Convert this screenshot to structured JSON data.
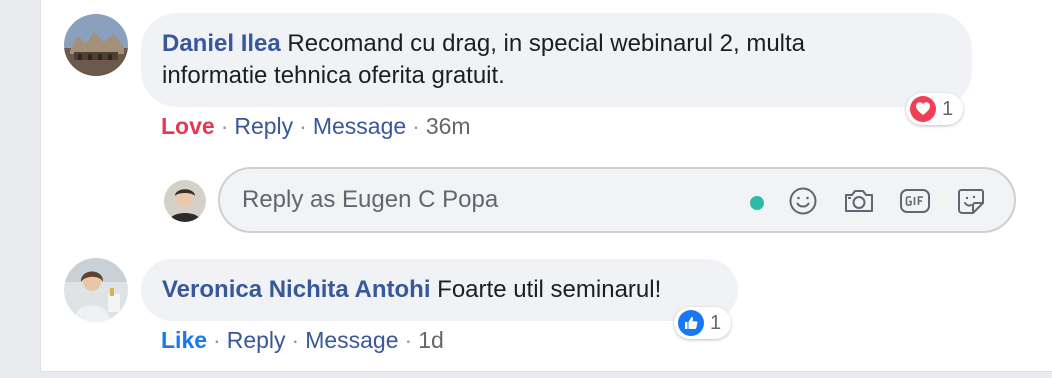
{
  "comments": [
    {
      "author": "Daniel Ilea",
      "text_line1": "Recomand cu drag, in special webinarul 2, multa",
      "text_line2": "informatie tehnica oferita gratuit.",
      "reaction_label": "Love",
      "reply_label": "Reply",
      "message_label": "Message",
      "time": "36m",
      "reaction_count": "1",
      "reaction_type": "heart-icon"
    },
    {
      "author": "Veronica Nichita Antohi",
      "text": "Foarte util seminarul!",
      "reaction_label": "Like",
      "reply_label": "Reply",
      "message_label": "Message",
      "time": "1d",
      "reaction_count": "1",
      "reaction_type": "thumbs-up-icon"
    }
  ],
  "reply_box": {
    "placeholder": "Reply as Eugen C Popa"
  },
  "separator": "·",
  "colors": {
    "love": "#e63950",
    "like": "#1877f2",
    "link": "#385898",
    "online": "#2abba7"
  }
}
